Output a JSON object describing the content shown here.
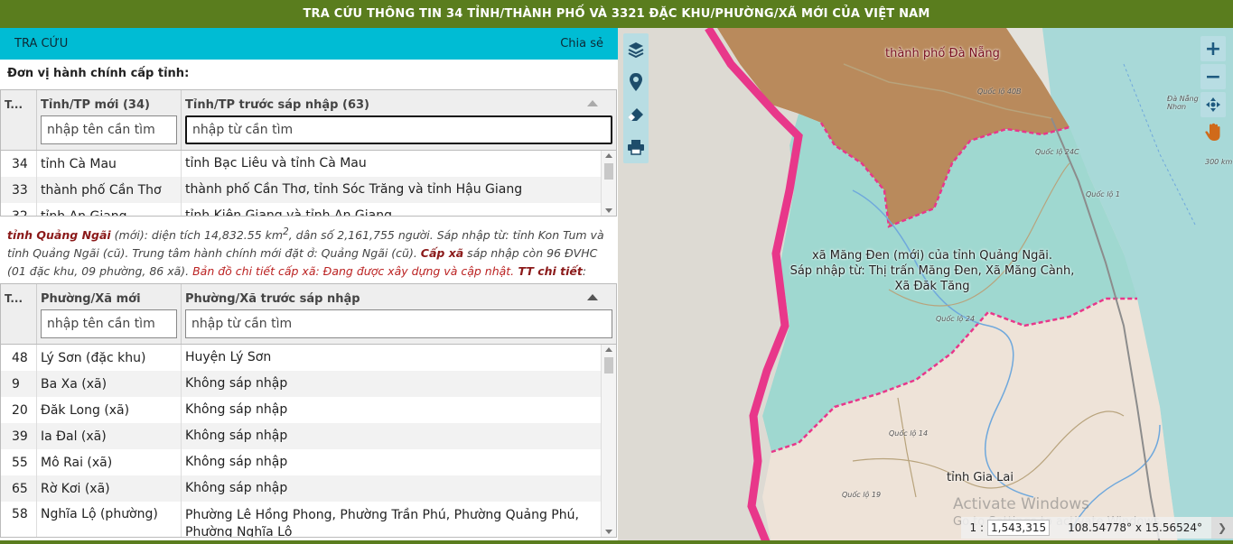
{
  "header": {
    "title": "TRA CỨU THÔNG TIN 34 TỈNH/THÀNH PHỐ VÀ 3321 ĐẶC KHU/PHƯỜNG/XÃ MỚI CỦA VIỆT NAM"
  },
  "toolbar": {
    "search_label": "TRA CỨU",
    "share_label": "Chia sẻ"
  },
  "province_section": {
    "label": "Đơn vị hành chính cấp tỉnh:",
    "columns": {
      "stt": "T...",
      "new": "Tỉnh/TP mới (34)",
      "old": "Tỉnh/TP trước sáp nhập (63)"
    },
    "filters": {
      "new_placeholder": "nhập tên cần tìm",
      "old_placeholder": "nhập từ cần tìm"
    },
    "rows": [
      {
        "stt": "34",
        "new": "tỉnh Cà Mau",
        "old": "tỉnh Bạc Liêu và tỉnh Cà Mau"
      },
      {
        "stt": "33",
        "new": "thành phố Cần Thơ",
        "old": "thành phố Cần Thơ, tỉnh Sóc Trăng và tỉnh Hậu Giang"
      },
      {
        "stt": "32",
        "new": "tỉnh An Giang",
        "old": "tỉnh Kiên Giang và tỉnh An Giang"
      }
    ]
  },
  "info": {
    "name": "tỉnh Quảng Ngãi",
    "t1": " (mới): diện tích 14,832.55 km",
    "sup": "2",
    "t2": ", dân số 2,161,755 người. Sáp nhập từ: tỉnh Kon Tum và tỉnh Quảng Ngãi (cũ). Trung tâm hành chính mới đặt ở: Quảng Ngãi (cũ). ",
    "cap_xa": "Cấp xã",
    "t3": " sáp nhập còn 96 ĐVHC (01 đặc khu, 09 phường, 86 xã). ",
    "map_note": "Bản đồ chi tiết cấp xã: Đang được xây dựng và cập nhật.",
    "tt": " TT chi tiết",
    "colon": ":"
  },
  "commune_section": {
    "columns": {
      "stt": "T...",
      "new": "Phường/Xã mới",
      "old": "Phường/Xã trước sáp nhập"
    },
    "filters": {
      "new_placeholder": "nhập tên cần tìm",
      "old_placeholder": "nhập từ cần tìm"
    },
    "rows": [
      {
        "stt": "48",
        "new": "Lý Sơn (đặc khu)",
        "old": "Huyện Lý Sơn"
      },
      {
        "stt": "9",
        "new": "Ba Xa (xã)",
        "old": "Không sáp nhập"
      },
      {
        "stt": "20",
        "new": "Đăk Long (xã)",
        "old": "Không sáp nhập"
      },
      {
        "stt": "39",
        "new": "Ia Đal (xã)",
        "old": "Không sáp nhập"
      },
      {
        "stt": "55",
        "new": "Mô Rai (xã)",
        "old": "Không sáp nhập"
      },
      {
        "stt": "65",
        "new": "Rờ Kơi (xã)",
        "old": "Không sáp nhập"
      },
      {
        "stt": "58",
        "new": "Nghĩa Lộ (phường)",
        "old": "Phường Lê Hồng Phong, Phường Trần Phú, Phường Quảng Phú, Phường Nghĩa Lộ"
      }
    ]
  },
  "map": {
    "labels": {
      "danang": "thành phố Đà Nẵng",
      "commune_line1": "xã Măng Đen (mới) của tỉnh Quảng Ngãi.",
      "commune_line2": "Sáp nhập từ: Thị trấn Măng Đen, Xã Măng Cành,",
      "commune_line3": "Xã Đăk Tăng",
      "gialai": "tỉnh Gia Lai"
    },
    "roads": [
      "Quốc lộ 40B",
      "Quốc lộ 24C",
      "Quốc lộ 1",
      "Quốc lộ 24",
      "Quốc lộ 14",
      "Quốc lộ 19",
      "Đà Nẵng - Quy Nhơn",
      "300 km"
    ],
    "scale_prefix": "1 :",
    "scale_value": "1,543,315",
    "coords": "108.54778° x 15.56524°",
    "watermark_line1": "Activate Windows",
    "watermark_line2": "Go to Settings to activate Windows.",
    "tools": [
      "layers-icon",
      "location-pin-icon",
      "eraser-icon",
      "print-icon"
    ],
    "colors": {
      "danang": "#b98a5c",
      "quangngai": "#9fd8d0",
      "gialai": "#eee3d8",
      "border": "#e8378a",
      "sea": "#a8d9d8"
    }
  },
  "colors": {
    "header_bg": "#5a7d1e",
    "toolbar_bg": "#00bcd4"
  }
}
